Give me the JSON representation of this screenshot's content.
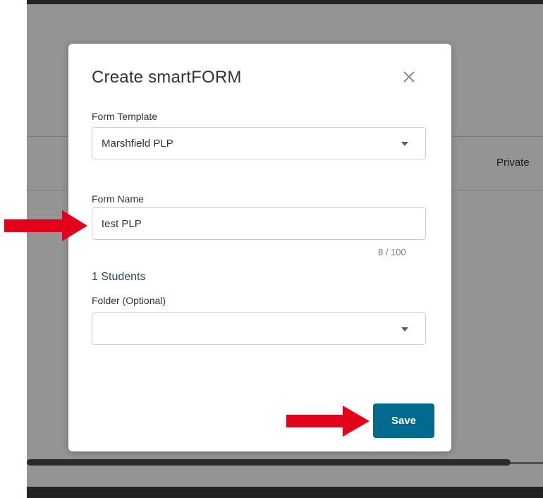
{
  "background": {
    "column_header": "Private"
  },
  "modal": {
    "title": "Create smartFORM",
    "form_template": {
      "label": "Form Template",
      "value": "Marshfield PLP"
    },
    "form_name": {
      "label": "Form Name",
      "value": "test PLP",
      "counter": "8 / 100"
    },
    "students_count": "1 Students",
    "folder": {
      "label": "Folder (Optional)",
      "value": ""
    },
    "save_label": "Save"
  },
  "colors": {
    "save_button": "#006b8f",
    "arrow": "#e3001b",
    "students_text": "#2d4a63"
  }
}
